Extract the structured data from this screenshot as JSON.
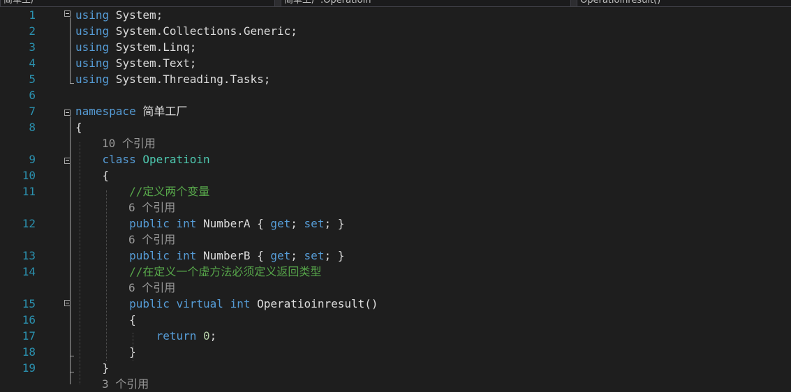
{
  "nav": {
    "project": "简单工厂",
    "class": "简单工厂.Operatioin",
    "member": "Operatioinresult()"
  },
  "lines": [
    {
      "num": "1",
      "tokens": [
        {
          "t": "using",
          "c": "kw"
        },
        {
          "t": " System;",
          "c": "pl"
        }
      ]
    },
    {
      "num": "2",
      "tokens": [
        {
          "t": "using",
          "c": "kw"
        },
        {
          "t": " System.Collections.Generic;",
          "c": "pl"
        }
      ]
    },
    {
      "num": "3",
      "tokens": [
        {
          "t": "using",
          "c": "kw"
        },
        {
          "t": " System.Linq;",
          "c": "pl"
        }
      ]
    },
    {
      "num": "4",
      "tokens": [
        {
          "t": "using",
          "c": "kw"
        },
        {
          "t": " System.Text;",
          "c": "pl"
        }
      ]
    },
    {
      "num": "5",
      "tokens": [
        {
          "t": "using",
          "c": "kw"
        },
        {
          "t": " System.Threading.Tasks;",
          "c": "pl"
        }
      ]
    },
    {
      "num": "6",
      "tokens": []
    },
    {
      "num": "7",
      "tokens": [
        {
          "t": "namespace",
          "c": "kw"
        },
        {
          "t": " 简单工厂",
          "c": "pl"
        }
      ]
    },
    {
      "num": "8",
      "tokens": [
        {
          "t": "{",
          "c": "pl"
        }
      ]
    },
    {
      "lens": "10 个引用",
      "indent": 1
    },
    {
      "num": "9",
      "tokens": [
        {
          "t": "    ",
          "c": "pl"
        },
        {
          "t": "class",
          "c": "kw"
        },
        {
          "t": " ",
          "c": "pl"
        },
        {
          "t": "Operatioin",
          "c": "ty"
        }
      ]
    },
    {
      "num": "10",
      "tokens": [
        {
          "t": "    {",
          "c": "pl"
        }
      ]
    },
    {
      "num": "11",
      "tokens": [
        {
          "t": "        ",
          "c": "pl"
        },
        {
          "t": "//定义两个变量",
          "c": "cm"
        }
      ]
    },
    {
      "lens": "6 个引用",
      "indent": 2
    },
    {
      "num": "12",
      "tokens": [
        {
          "t": "        ",
          "c": "pl"
        },
        {
          "t": "public",
          "c": "kw"
        },
        {
          "t": " ",
          "c": "pl"
        },
        {
          "t": "int",
          "c": "kw"
        },
        {
          "t": " NumberA { ",
          "c": "pl"
        },
        {
          "t": "get",
          "c": "kw"
        },
        {
          "t": "; ",
          "c": "pl"
        },
        {
          "t": "set",
          "c": "kw"
        },
        {
          "t": "; }",
          "c": "pl"
        }
      ]
    },
    {
      "lens": "6 个引用",
      "indent": 2
    },
    {
      "num": "13",
      "tokens": [
        {
          "t": "        ",
          "c": "pl"
        },
        {
          "t": "public",
          "c": "kw"
        },
        {
          "t": " ",
          "c": "pl"
        },
        {
          "t": "int",
          "c": "kw"
        },
        {
          "t": " NumberB { ",
          "c": "pl"
        },
        {
          "t": "get",
          "c": "kw"
        },
        {
          "t": "; ",
          "c": "pl"
        },
        {
          "t": "set",
          "c": "kw"
        },
        {
          "t": "; }",
          "c": "pl"
        }
      ]
    },
    {
      "num": "14",
      "tokens": [
        {
          "t": "        ",
          "c": "pl"
        },
        {
          "t": "//在定义一个虚方法必须定义返回类型",
          "c": "cm"
        }
      ]
    },
    {
      "lens": "6 个引用",
      "indent": 2
    },
    {
      "num": "15",
      "tokens": [
        {
          "t": "        ",
          "c": "pl"
        },
        {
          "t": "public",
          "c": "kw"
        },
        {
          "t": " ",
          "c": "pl"
        },
        {
          "t": "virtual",
          "c": "kw"
        },
        {
          "t": " ",
          "c": "pl"
        },
        {
          "t": "int",
          "c": "kw"
        },
        {
          "t": " Operatioinresult()",
          "c": "pl"
        }
      ]
    },
    {
      "num": "16",
      "tokens": [
        {
          "t": "        {",
          "c": "pl"
        }
      ]
    },
    {
      "num": "17",
      "tokens": [
        {
          "t": "            ",
          "c": "pl"
        },
        {
          "t": "return",
          "c": "kw"
        },
        {
          "t": " ",
          "c": "pl"
        },
        {
          "t": "0",
          "c": "nu"
        },
        {
          "t": ";",
          "c": "pl"
        }
      ]
    },
    {
      "num": "18",
      "tokens": [
        {
          "t": "        }",
          "c": "pl"
        }
      ]
    },
    {
      "num": "19",
      "tokens": [
        {
          "t": "    }",
          "c": "pl"
        }
      ]
    },
    {
      "lens": "3 个引用",
      "indent": 1
    }
  ]
}
